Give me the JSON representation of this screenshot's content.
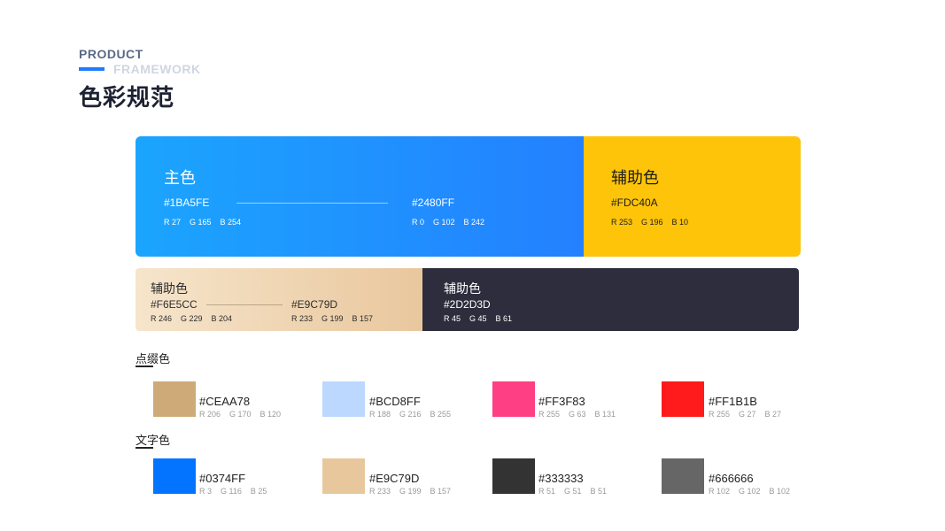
{
  "header": {
    "product": "PRODUCT",
    "framework": "FRAMEWORK",
    "title": "色彩规范"
  },
  "primary": {
    "title": "主色",
    "left_hex": "#1BA5FE",
    "left_rgb": "R 27    G 165    B 254",
    "right_hex": "#2480FF",
    "right_rgb": "R 0    G 102    B 242",
    "color_from": "#1BA5FE",
    "color_to": "#2480FF"
  },
  "accent": {
    "title": "辅助色",
    "hex": "#FDC40A",
    "rgb": "R 253    G 196    B 10",
    "color": "#FDC40A"
  },
  "beige": {
    "title": "辅助色",
    "left_hex": "#F6E5CC",
    "left_rgb": "R 246    G 229    B 204",
    "right_hex": "#E9C79D",
    "right_rgb": "R 233    G 199    B 157"
  },
  "dark": {
    "title": "辅助色",
    "hex": "#2D2D3D",
    "rgb": "R 45    G 45    B 61"
  },
  "highlight_section": {
    "label": "点缀色",
    "swatches": [
      {
        "hex": "#CEAA78",
        "rgb": "R 206    G 170    B 120",
        "color": "#CEAA78"
      },
      {
        "hex": "#BCD8FF",
        "rgb": "R 188    G 216    B 255",
        "color": "#BCD8FF"
      },
      {
        "hex": "#FF3F83",
        "rgb": "R 255    G 63    B 131",
        "color": "#FF3F83"
      },
      {
        "hex": "#FF1B1B",
        "rgb": "R 255    G 27    B 27",
        "color": "#FF1B1B"
      }
    ]
  },
  "text_section": {
    "label": "文字色",
    "swatches": [
      {
        "hex": "#0374FF",
        "rgb": "R 3    G 116    B 25",
        "color": "#0374FF"
      },
      {
        "hex": "#E9C79D",
        "rgb": "R 233    G 199    B 157",
        "color": "#E9C79D"
      },
      {
        "hex": "#333333",
        "rgb": "R 51    G 51    B 51",
        "color": "#333333"
      },
      {
        "hex": "#666666",
        "rgb": "R 102    G 102    B 102",
        "color": "#666666"
      }
    ]
  }
}
